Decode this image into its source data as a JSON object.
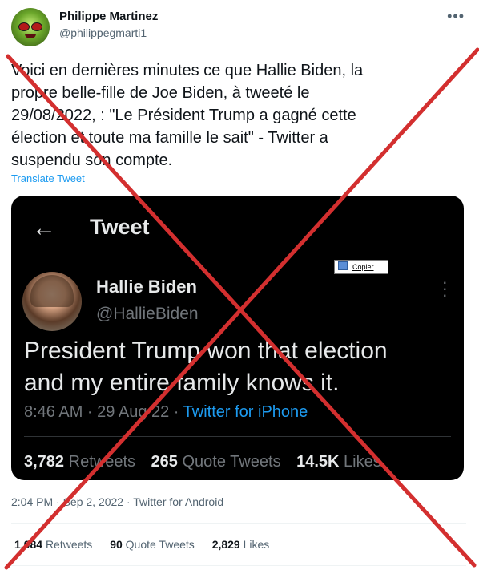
{
  "author": {
    "display_name": "Philippe Martinez",
    "handle": "@philippegmarti1",
    "more_icon": "more-horizontal-icon"
  },
  "tweet": {
    "text_lines": [
      "Voici en dernières minutes ce que Hallie Biden, la",
      "propre belle-fille de Joe Biden, à tweeté le",
      "29/08/2022,  : \"Le Président Trump a gagné cette",
      "élection et toute ma famille le sait\" - Twitter a",
      "suspendu son compte."
    ],
    "translate_label": "Translate Tweet",
    "timestamp": "2:04 PM · Sep 2, 2022 · Twitter for Android",
    "stats": {
      "retweets_count": "1,084",
      "retweets_label": "Retweets",
      "quotes_count": "90",
      "quotes_label": "Quote Tweets",
      "likes_count": "2,829",
      "likes_label": "Likes"
    }
  },
  "screenshot": {
    "header_title": "Tweet",
    "back_icon": "arrow-left-icon",
    "copy_popup_label": "Copier",
    "author_name": "Hallie Biden",
    "author_handle": "@HallieBiden",
    "text_lines": [
      "President Trump won that election",
      "and my entire family knows it."
    ],
    "meta_time": "8:46 AM · 29 Aug 22 · ",
    "meta_source": "Twitter for iPhone",
    "stats": {
      "retweets_count": "3,782",
      "retweets_label": "Retweets",
      "quotes_count": "265",
      "quotes_label": "Quote Tweets",
      "likes_count": "14.5K",
      "likes_label": "Likes"
    }
  },
  "overlay": {
    "cross_color": "#d32f2f"
  },
  "colors": {
    "link_blue": "#1d9bf0",
    "muted_gray": "#536471",
    "dark_bg": "#000000"
  }
}
